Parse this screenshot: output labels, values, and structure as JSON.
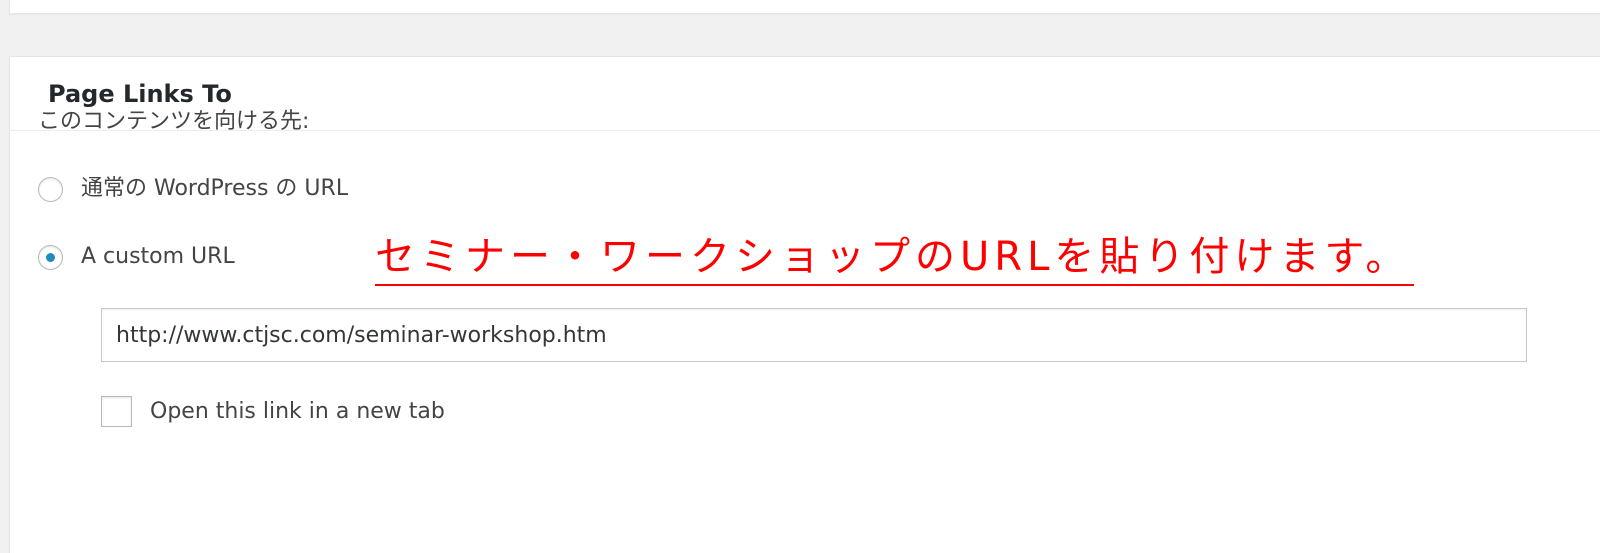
{
  "metabox": {
    "title": "Page Links To",
    "intro": "このコンテンツを向ける先:",
    "options": [
      {
        "label": "通常の WordPress の URL",
        "checked": false
      },
      {
        "label": "A custom URL",
        "checked": true
      }
    ],
    "url_value": "http://www.ctjsc.com/seminar-workshop.htm",
    "new_tab_label": "Open this link in a new tab",
    "new_tab_checked": false
  },
  "annotation": {
    "text": "セミナー・ワークショップのURLを貼り付けます。",
    "color": "#ff0000"
  },
  "colors": {
    "background": "#f1f1f1",
    "panel": "#ffffff",
    "radio_dot": "#1e8cbe"
  }
}
